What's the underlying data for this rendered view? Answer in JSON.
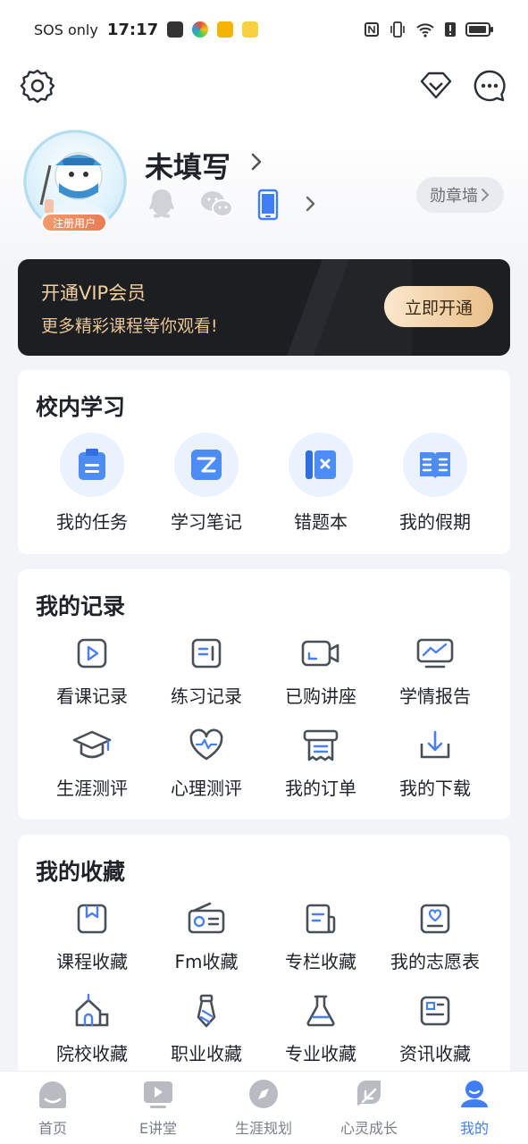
{
  "status_bar": {
    "carrier": "SOS only",
    "time": "17:17"
  },
  "profile": {
    "username": "未填写",
    "badge": "注册用户",
    "medal_wall": "勋章墙"
  },
  "vip": {
    "title": "开通VIP会员",
    "subtitle": "更多精彩课程等你观看!",
    "button": "立即开通"
  },
  "campus": {
    "title": "校内学习",
    "items": [
      {
        "label": "我的任务",
        "icon": "clipboard-icon"
      },
      {
        "label": "学习笔记",
        "icon": "note-icon"
      },
      {
        "label": "错题本",
        "icon": "wrong-book-icon"
      },
      {
        "label": "我的假期",
        "icon": "open-book-icon"
      }
    ]
  },
  "records": {
    "title": "我的记录",
    "items": [
      {
        "label": "看课记录",
        "icon": "play-icon"
      },
      {
        "label": "练习记录",
        "icon": "practice-icon"
      },
      {
        "label": "已购讲座",
        "icon": "video-camera-icon"
      },
      {
        "label": "学情报告",
        "icon": "monitor-chart-icon"
      },
      {
        "label": "生涯测评",
        "icon": "graduation-cap-icon"
      },
      {
        "label": "心理测评",
        "icon": "heart-pulse-icon"
      },
      {
        "label": "我的订单",
        "icon": "receipt-icon"
      },
      {
        "label": "我的下载",
        "icon": "download-icon"
      }
    ]
  },
  "favorites": {
    "title": "我的收藏",
    "items": [
      {
        "label": "课程收藏",
        "icon": "course-bookmark-icon"
      },
      {
        "label": "Fm收藏",
        "icon": "radio-icon"
      },
      {
        "label": "专栏收藏",
        "icon": "column-icon"
      },
      {
        "label": "我的志愿表",
        "icon": "heart-form-icon"
      },
      {
        "label": "院校收藏",
        "icon": "school-icon"
      },
      {
        "label": "职业收藏",
        "icon": "tie-icon"
      },
      {
        "label": "专业收藏",
        "icon": "flask-icon"
      },
      {
        "label": "资讯收藏",
        "icon": "news-icon"
      }
    ]
  },
  "tabbar": {
    "items": [
      {
        "label": "首页",
        "icon": "home-icon"
      },
      {
        "label": "E讲堂",
        "icon": "video-play-icon"
      },
      {
        "label": "生涯规划",
        "icon": "compass-icon"
      },
      {
        "label": "心灵成长",
        "icon": "leaf-icon"
      },
      {
        "label": "我的",
        "icon": "profile-icon"
      }
    ],
    "active": "我的"
  },
  "colors": {
    "accent": "#3f7ef7",
    "vip_gold": "#e9c08b",
    "icon_gray": "#4a5058"
  }
}
